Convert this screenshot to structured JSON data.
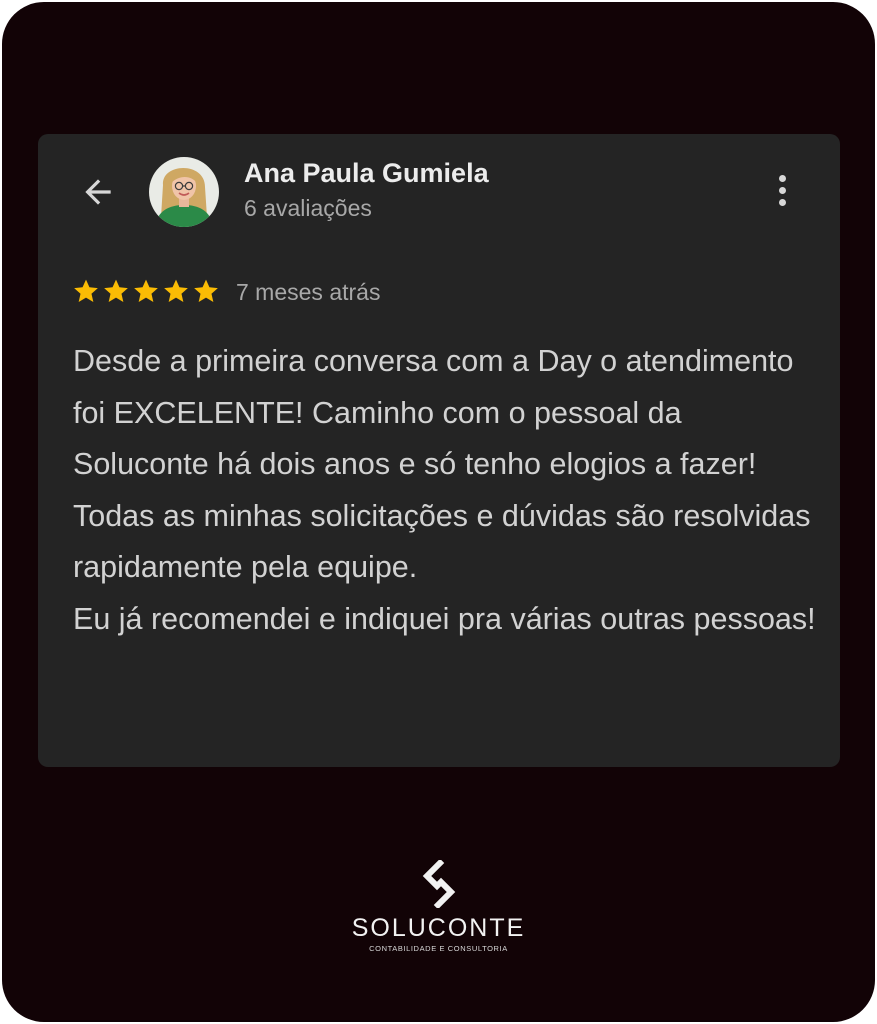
{
  "review": {
    "reviewer_name": "Ana Paula Gumiela",
    "reviewer_reviews": "6 avaliações",
    "rating": 5,
    "rating_max": 5,
    "time_ago": "7 meses atrás",
    "text_paragraphs": [
      "Desde a primeira conversa com a Day o atendimento foi EXCELENTE! Caminho com o pessoal da Soluconte há dois anos e só tenho elogios a fazer!",
      "Todas as minhas solicitações e dúvidas são resolvidas rapidamente pela equipe.",
      "Eu já recomendei e indiquei pra várias outras pessoas!"
    ]
  },
  "toolbar": {
    "back_icon": "arrow-left-icon",
    "more_icon": "more-vertical-icon"
  },
  "brand": {
    "name": "SOLUCONTE",
    "tagline": "CONTABILIDADE E CONSULTORIA"
  },
  "colors": {
    "background": "#120306",
    "card": "#242424",
    "star": "#fbbc04",
    "name_text": "#ececec",
    "secondary_text": "#a8a8a8",
    "body_text": "#d2d2d2"
  }
}
